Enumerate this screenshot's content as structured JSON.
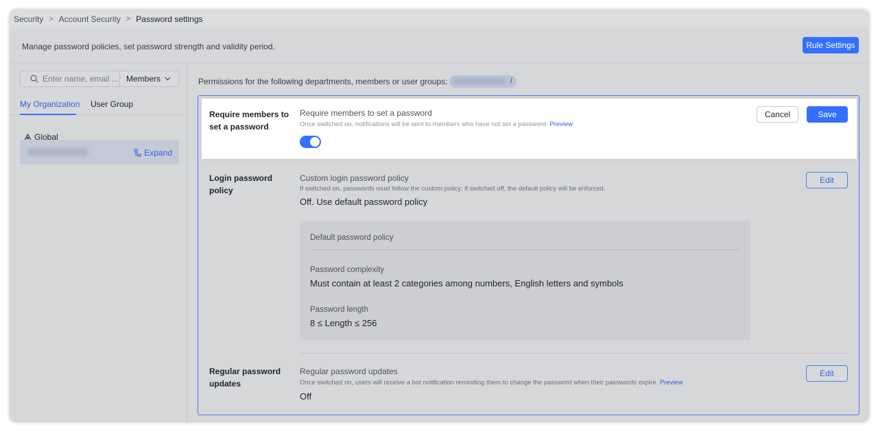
{
  "breadcrumb": {
    "items": [
      "Security",
      "Account Security"
    ],
    "current": "Password settings",
    "separator": ">"
  },
  "header": {
    "description": "Manage password policies, set password strength and validity period.",
    "rule_settings_label": "Rule Settings"
  },
  "sidebar": {
    "search_placeholder": "Enter name, email ...",
    "filter_label": "Members",
    "tabs": [
      {
        "label": "My Organization",
        "active": true
      },
      {
        "label": "User Group",
        "active": false
      }
    ],
    "global_label": "Global",
    "expand_label": "Expand"
  },
  "main": {
    "permissions_text": "Permissions for the following departments, members or user groups:",
    "permissions_info_icon": "i",
    "require_password": {
      "label_line1": "Require members to",
      "label_line2": "set a password",
      "title": "Require members to set a password",
      "subtitle": "Once switched on, notifications will be sent to members who have not set a password.",
      "preview_link": "Preview",
      "toggle_on": true,
      "cancel_label": "Cancel",
      "save_label": "Save"
    },
    "login_policy": {
      "label_line1": "Login password",
      "label_line2": "policy",
      "title": "Custom login password policy",
      "subtitle": "If switched on, passwords must follow the custom policy; if switched off, the default policy will be enforced.",
      "value": "Off. Use default password policy",
      "edit_label": "Edit",
      "default_policy": {
        "heading": "Default password policy",
        "complexity_label": "Password complexity",
        "complexity_value": "Must contain at least 2 categories among numbers, English letters and symbols",
        "length_label": "Password length",
        "length_value": "8 ≤ Length ≤ 256"
      }
    },
    "regular_updates": {
      "label_line1": "Regular password",
      "label_line2": "updates",
      "title": "Regular password updates",
      "subtitle": "Once switched on, users will receive a bot notification reminding them to change the password when their passwords expire.",
      "preview_link": "Preview",
      "value": "Off",
      "edit_label": "Edit"
    }
  },
  "colors": {
    "accent": "#3370ff",
    "link": "#2f63d8",
    "panel_border": "#4f7de6"
  }
}
